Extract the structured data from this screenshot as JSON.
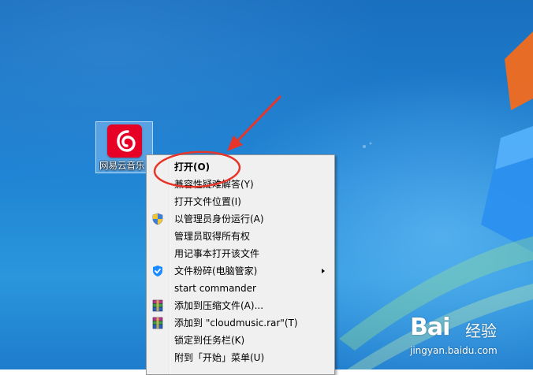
{
  "desktop": {
    "icon": {
      "label": "网易云音乐",
      "icon_name": "netease-cloud-music-icon",
      "tile_color": "#e60026"
    }
  },
  "context_menu": {
    "items": [
      {
        "label": "打开(O)",
        "bold": true,
        "icon": "",
        "submenu": false
      },
      {
        "label": "兼容性疑难解答(Y)",
        "bold": false,
        "icon": "",
        "submenu": false
      },
      {
        "label": "打开文件位置(I)",
        "bold": false,
        "icon": "",
        "submenu": false
      },
      {
        "label": "以管理员身份运行(A)",
        "bold": false,
        "icon": "uac-shield-icon",
        "submenu": false
      },
      {
        "label": "管理员取得所有权",
        "bold": false,
        "icon": "",
        "submenu": false
      },
      {
        "label": "用记事本打开该文件",
        "bold": false,
        "icon": "",
        "submenu": false
      },
      {
        "label": "文件粉碎(电脑管家)",
        "bold": false,
        "icon": "tencent-pc-manager-icon",
        "submenu": true
      },
      {
        "label": "start commander",
        "bold": false,
        "icon": "",
        "submenu": false
      },
      {
        "label": "添加到压缩文件(A)...",
        "bold": false,
        "icon": "winrar-icon",
        "submenu": false
      },
      {
        "label": "添加到 \"cloudmusic.rar\"(T)",
        "bold": false,
        "icon": "winrar-icon",
        "submenu": false
      },
      {
        "label": "锁定到任务栏(K)",
        "bold": false,
        "icon": "",
        "submenu": false
      },
      {
        "label": "附到「开始」菜单(U)",
        "bold": false,
        "icon": "",
        "submenu": false
      }
    ]
  },
  "annotation": {
    "color": "#e8352a"
  },
  "watermark": {
    "brand": "Bai",
    "brand_suffix": "经验",
    "url": "jingyan.baidu.com"
  }
}
